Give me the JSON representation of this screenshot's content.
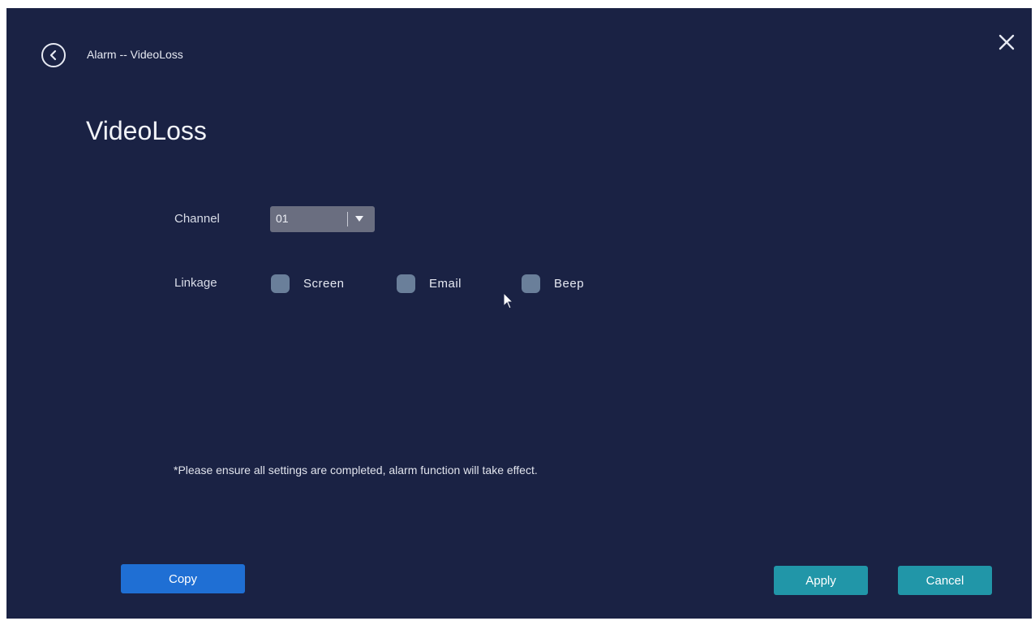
{
  "header": {
    "breadcrumb": "Alarm -- VideoLoss"
  },
  "page": {
    "title": "VideoLoss"
  },
  "form": {
    "channel_label": "Channel",
    "channel_value": "01",
    "linkage_label": "Linkage",
    "linkage_options": [
      {
        "label": "Screen",
        "checked": false
      },
      {
        "label": "Email",
        "checked": false
      },
      {
        "label": "Beep",
        "checked": false
      }
    ]
  },
  "note": "*Please ensure all settings are completed, alarm function will take effect.",
  "footer": {
    "copy_label": "Copy",
    "apply_label": "Apply",
    "cancel_label": "Cancel"
  },
  "icons": {
    "back": "chevron-left-circle-icon",
    "close": "close-icon",
    "dropdown": "caret-down-icon",
    "cursor": "mouse-pointer-icon"
  },
  "colors": {
    "background": "#1a2244",
    "select_bg": "#6a6e80",
    "checkbox": "#6a7f9a",
    "copy_button": "#1f6fd4",
    "action_button": "#2196a8"
  }
}
